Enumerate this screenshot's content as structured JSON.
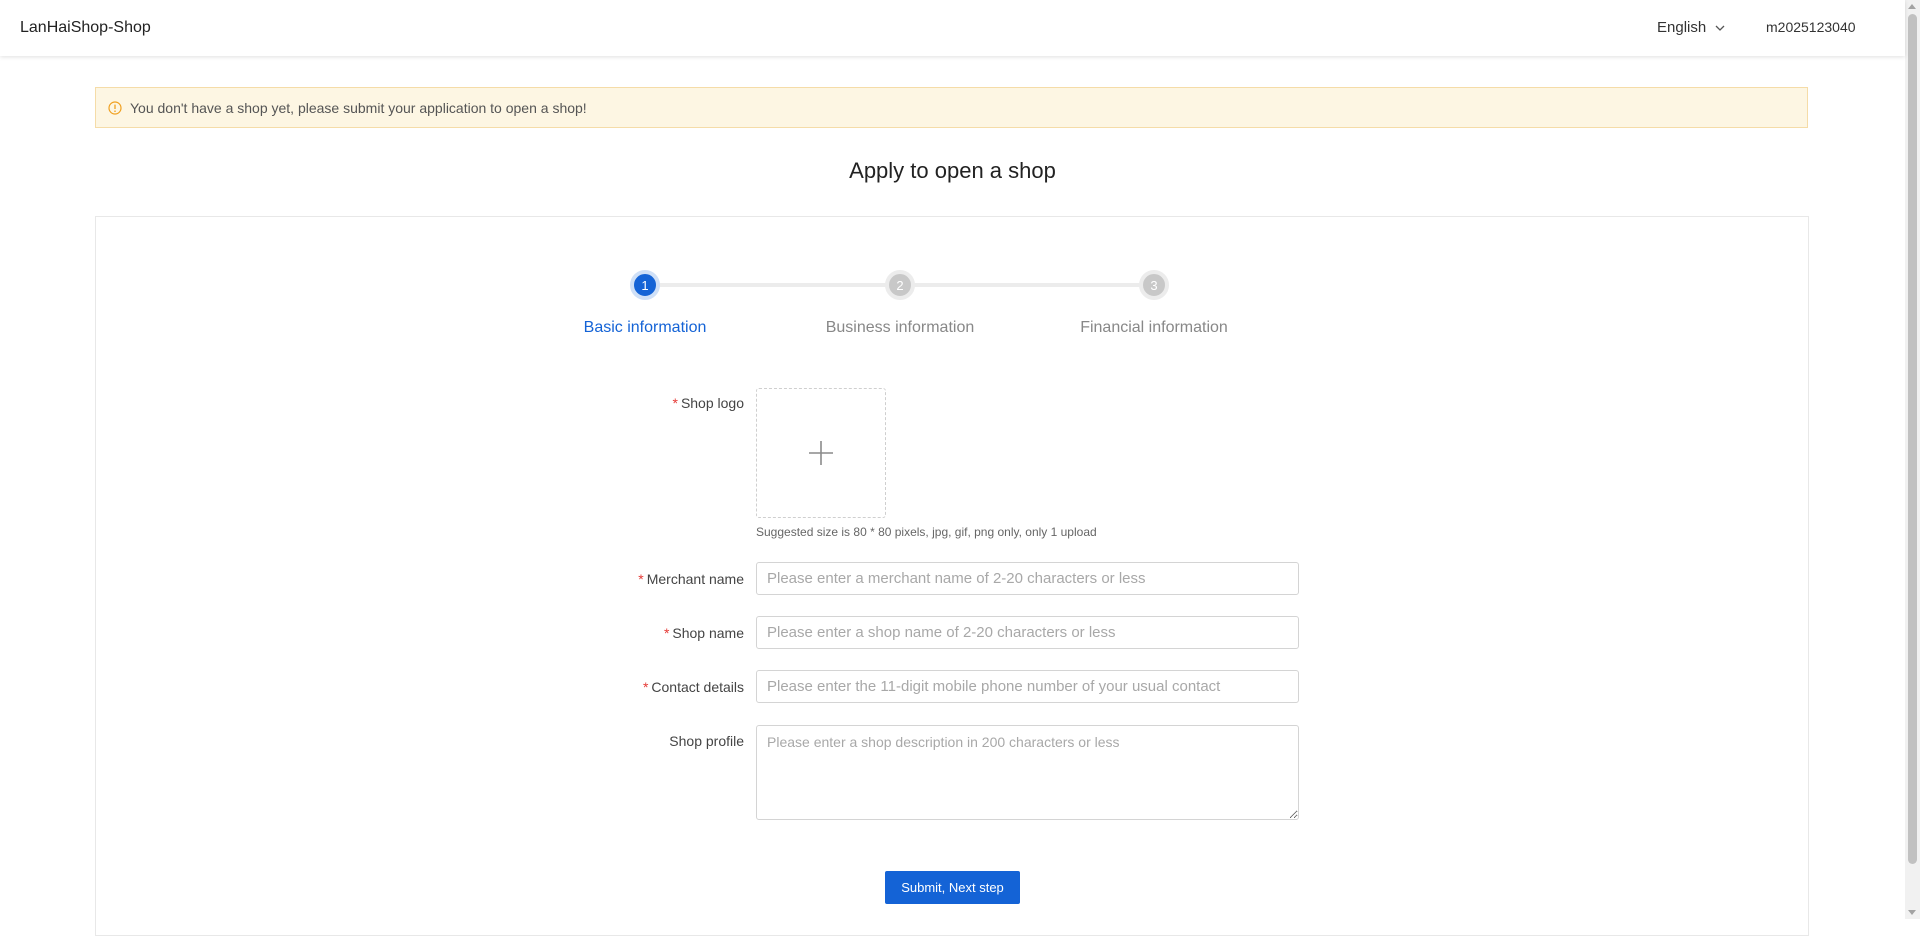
{
  "header": {
    "brand": "LanHaiShop-Shop",
    "language": "English",
    "username": "m2025123040"
  },
  "alert": {
    "message": "You don't have a shop yet, please submit your application to open a shop!"
  },
  "page": {
    "title": "Apply to open a shop"
  },
  "steps": [
    {
      "number": "1",
      "label": "Basic information",
      "active": true
    },
    {
      "number": "2",
      "label": "Business information",
      "active": false
    },
    {
      "number": "3",
      "label": "Financial information",
      "active": false
    }
  ],
  "form": {
    "required_mark": "*",
    "shop_logo": {
      "label": "Shop logo",
      "hint": "Suggested size is 80 * 80 pixels, jpg, gif, png only, only 1 upload"
    },
    "merchant_name": {
      "label": "Merchant name",
      "placeholder": "Please enter a merchant name of 2-20 characters or less"
    },
    "shop_name": {
      "label": "Shop name",
      "placeholder": "Please enter a shop name of 2-20 characters or less"
    },
    "contact_details": {
      "label": "Contact details",
      "placeholder": "Please enter the 11-digit mobile phone number of your usual contact"
    },
    "shop_profile": {
      "label": "Shop profile",
      "placeholder": "Please enter a shop description in 200 characters or less"
    },
    "submit_label": "Submit, Next step"
  },
  "colors": {
    "primary": "#1463d6",
    "alert_bg": "#fdf6e3",
    "alert_icon": "#f0a020",
    "required": "#e53935"
  },
  "icons": {
    "alert": "info-circle-icon",
    "language": "chevron-down-icon",
    "upload": "plus-icon"
  }
}
